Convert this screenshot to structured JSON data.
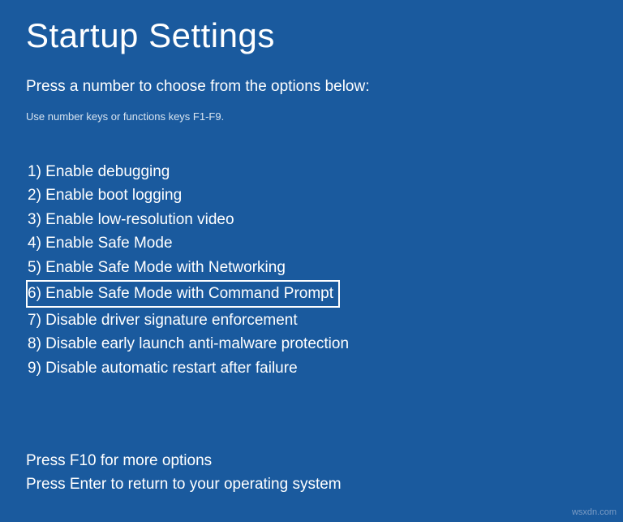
{
  "title": "Startup Settings",
  "instruction": "Press a number to choose from the options below:",
  "hint": "Use number keys or functions keys F1-F9.",
  "options": [
    {
      "num": "1",
      "label": "Enable debugging",
      "highlighted": false
    },
    {
      "num": "2",
      "label": "Enable boot logging",
      "highlighted": false
    },
    {
      "num": "3",
      "label": "Enable low-resolution video",
      "highlighted": false
    },
    {
      "num": "4",
      "label": "Enable Safe Mode",
      "highlighted": false
    },
    {
      "num": "5",
      "label": "Enable Safe Mode with Networking",
      "highlighted": false
    },
    {
      "num": "6",
      "label": "Enable Safe Mode with Command Prompt",
      "highlighted": true
    },
    {
      "num": "7",
      "label": "Disable driver signature enforcement",
      "highlighted": false
    },
    {
      "num": "8",
      "label": "Disable early launch anti-malware protection",
      "highlighted": false
    },
    {
      "num": "9",
      "label": "Disable automatic restart after failure",
      "highlighted": false
    }
  ],
  "footer": {
    "line1": "Press F10 for more options",
    "line2": "Press Enter to return to your operating system"
  },
  "watermark": "wsxdn.com"
}
